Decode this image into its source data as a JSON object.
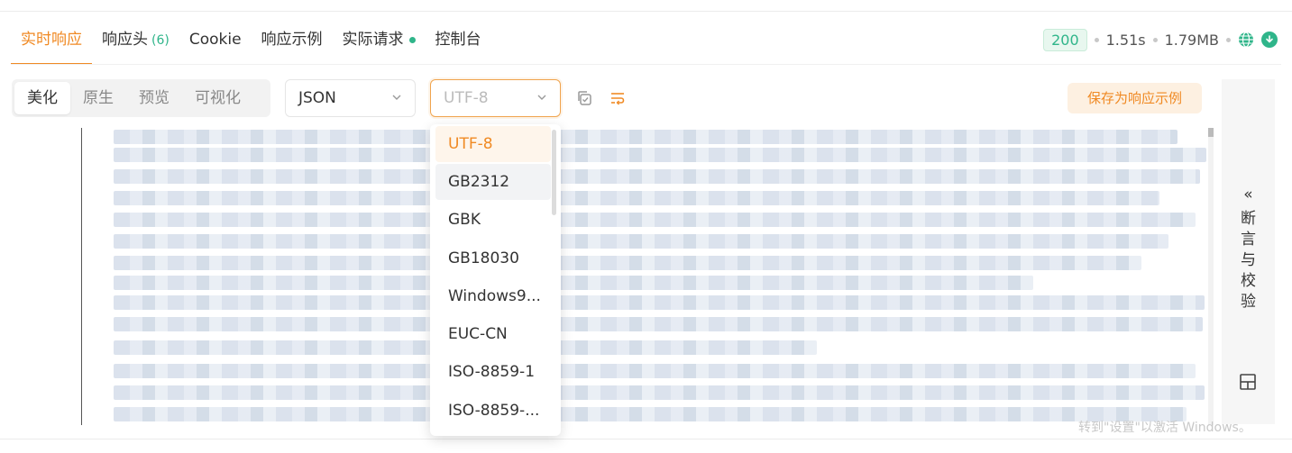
{
  "tabs": [
    {
      "label": "实时响应",
      "active": true
    },
    {
      "label": "响应头",
      "count": "(6)"
    },
    {
      "label": "Cookie"
    },
    {
      "label": "响应示例"
    },
    {
      "label": "实际请求",
      "dot": true
    },
    {
      "label": "控制台"
    }
  ],
  "status": {
    "code": "200",
    "time": "1.51s",
    "size": "1.79MB"
  },
  "view_modes": [
    "美化",
    "原生",
    "预览",
    "可视化"
  ],
  "format_select": "JSON",
  "encoding_select": {
    "placeholder": "UTF-8",
    "options": [
      "UTF-8",
      "GB2312",
      "GBK",
      "GB18030",
      "Windows9...",
      "EUC-CN",
      "ISO-8859-1",
      "ISO-8859-..."
    ]
  },
  "save_as_example": "保存为响应示例",
  "side_panel": {
    "assert_chars": [
      "断",
      "言",
      "与",
      "校",
      "验"
    ],
    "chevron": "«"
  },
  "os_watermark": "转到\"设置\"以激活 Windows。",
  "colors": {
    "accent": "#f08a24",
    "success": "#2fb58a"
  }
}
